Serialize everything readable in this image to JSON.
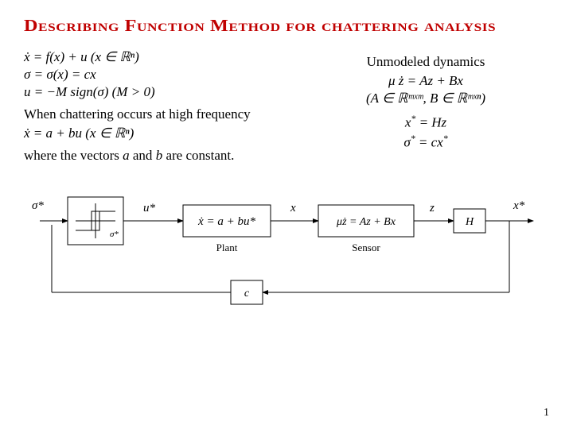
{
  "title": "Describing Function Method for chattering analysis",
  "left": {
    "eq1": "ẋ = f(x) + u    (x ∈ ℝⁿ)",
    "eq2": "σ = σ(x) = cx",
    "eq3": "u = −M sign(σ)    (M > 0)",
    "text1": "When chattering occurs at high frequency",
    "eq4": "ẋ = a + bu    (x ∈ ℝⁿ)",
    "text2": "where the vectors a and b are constant."
  },
  "right": {
    "heading": "Unmodeled dynamics",
    "eq1": "μ ż = Az + Bx",
    "eq2": "(A ∈ ℝᵐˣᵐ, B ∈ ℝᵐˣⁿ)",
    "eq3": "x* = Hz",
    "eq4": "σ* = cx*"
  },
  "diagram": {
    "sigma_star": "σ*",
    "u_star": "u*",
    "plant_eq": "ẋ = a + bu*",
    "plant_label": "Plant",
    "x": "x",
    "sensor_eq": "μż = Az + Bx",
    "sensor_label": "Sensor",
    "z": "z",
    "H": "H",
    "x_star": "x*",
    "c": "c"
  },
  "page": "1"
}
